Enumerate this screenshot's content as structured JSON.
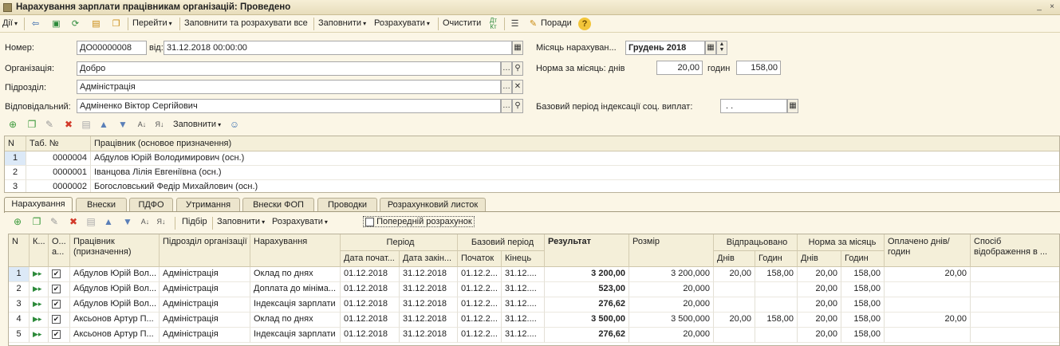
{
  "window": {
    "title": "Нарахування зарплати працівникам організацій: Проведено"
  },
  "toolbar": {
    "actions_label": "Дії",
    "goto_label": "Перейти",
    "fill_calc_all_label": "Заповнити та розрахувати все",
    "fill_label": "Заповнити",
    "calculate_label": "Розрахувати",
    "clear_label": "Очистити",
    "dt_kt_label": "Дт Кт",
    "tips_label": "Поради",
    "help_label": "?"
  },
  "form": {
    "number_label": "Номер:",
    "number_value": "ДО00000008",
    "from_label": "від:",
    "date_value": "31.12.2018 00:00:00",
    "organization_label": "Організація:",
    "organization_value": "Добро",
    "department_label": "Підрозділ:",
    "department_value": "Адміністрація",
    "responsible_label": "Відповідальний:",
    "responsible_value": "Адміненко Віктор Сергійович",
    "month_label": "Місяць нарахуван...",
    "month_value": "Грудень 2018",
    "norm_label": "Норма за місяць: днів",
    "norm_days_value": "20,00",
    "hours_label": "годин",
    "norm_hours_value": "158,00",
    "base_period_label": "Базовий період індексації соц. виплат:",
    "base_period_value": ". ."
  },
  "employees_toolbar": {
    "fill_label": "Заповнити"
  },
  "employees_table": {
    "headers": [
      "N",
      "Таб. №",
      "Працівник (основое призначення)"
    ],
    "rows": [
      {
        "n": "1",
        "tab": "0000004",
        "name": "Абдулов Юрій Володимирович (осн.)"
      },
      {
        "n": "2",
        "tab": "0000001",
        "name": "Іванцова Лілія Евгеніївна (осн.)"
      },
      {
        "n": "3",
        "tab": "0000002",
        "name": "Богословський Федір Михайлович (осн.)"
      }
    ]
  },
  "tabs": [
    {
      "label": "Нарахування"
    },
    {
      "label": "Внески"
    },
    {
      "label": "ПДФО"
    },
    {
      "label": "Утримання"
    },
    {
      "label": "Внески ФОП"
    },
    {
      "label": "Проводки"
    },
    {
      "label": "Розрахунковий листок"
    }
  ],
  "accruals_toolbar": {
    "selection_label": "Підбір",
    "fill_label": "Заповнити",
    "calculate_label": "Розрахувати",
    "preliminary_label": "Попередній розрахунок",
    "preliminary_checked": false
  },
  "accruals_table": {
    "headers": {
      "n": "N",
      "k": "К...",
      "o": "О... а...",
      "employee": "Працівник (призначення)",
      "department": "Підрозділ організації",
      "accrual": "Нарахування",
      "period": "Період",
      "period_start": "Дата почат...",
      "period_end": "Дата закін...",
      "base_period": "Базовий період",
      "base_start": "Початок",
      "base_end": "Кінець",
      "result": "Результат",
      "size": "Розмір",
      "worked": "Відпрацьовано",
      "worked_days": "Днів",
      "worked_hours": "Годин",
      "norm": "Норма за місяць",
      "norm_days": "Днів",
      "norm_hours": "Годин",
      "paid": "Оплачено днів/годин",
      "display_method": "Спосіб відображення в ..."
    },
    "rows": [
      {
        "n": "1",
        "employee": "Абдулов Юрій Вол...",
        "department": "Адміністрація",
        "accrual": "Оклад по днях",
        "start": "01.12.2018",
        "end": "31.12.2018",
        "b_start": "01.12.2...",
        "b_end": "31.12....",
        "result": "3 200,00",
        "size": "3 200,000",
        "w_days": "20,00",
        "w_hours": "158,00",
        "n_days": "20,00",
        "n_hours": "158,00",
        "paid": "20,00",
        "method": ""
      },
      {
        "n": "2",
        "employee": "Абдулов Юрій Вол...",
        "department": "Адміністрація",
        "accrual": "Доплата до мініма...",
        "start": "01.12.2018",
        "end": "31.12.2018",
        "b_start": "01.12.2...",
        "b_end": "31.12....",
        "result": "523,00",
        "size": "20,000",
        "w_days": "",
        "w_hours": "",
        "n_days": "20,00",
        "n_hours": "158,00",
        "paid": "",
        "method": ""
      },
      {
        "n": "3",
        "employee": "Абдулов Юрій Вол...",
        "department": "Адміністрація",
        "accrual": "Індексація зарплати",
        "start": "01.12.2018",
        "end": "31.12.2018",
        "b_start": "01.12.2...",
        "b_end": "31.12....",
        "result": "276,62",
        "size": "20,000",
        "w_days": "",
        "w_hours": "",
        "n_days": "20,00",
        "n_hours": "158,00",
        "paid": "",
        "method": ""
      },
      {
        "n": "4",
        "employee": "Аксьонов Артур П...",
        "department": "Адміністрація",
        "accrual": "Оклад по днях",
        "start": "01.12.2018",
        "end": "31.12.2018",
        "b_start": "01.12.2...",
        "b_end": "31.12....",
        "result": "3 500,00",
        "size": "3 500,000",
        "w_days": "20,00",
        "w_hours": "158,00",
        "n_days": "20,00",
        "n_hours": "158,00",
        "paid": "20,00",
        "method": ""
      },
      {
        "n": "5",
        "employee": "Аксьонов Артур П...",
        "department": "Адміністрація",
        "accrual": "Індексація зарплати",
        "start": "01.12.2018",
        "end": "31.12.2018",
        "b_start": "01.12.2...",
        "b_end": "31.12....",
        "result": "276,62",
        "size": "20,000",
        "w_days": "",
        "w_hours": "",
        "n_days": "20,00",
        "n_hours": "158,00",
        "paid": "",
        "method": ""
      }
    ]
  },
  "colors": {
    "background": "#fbf6e6",
    "header_bg": "#f4efd9",
    "selection": "#dce9f7",
    "add_green": "#3c9a3c",
    "delete_red": "#d23a2a"
  }
}
